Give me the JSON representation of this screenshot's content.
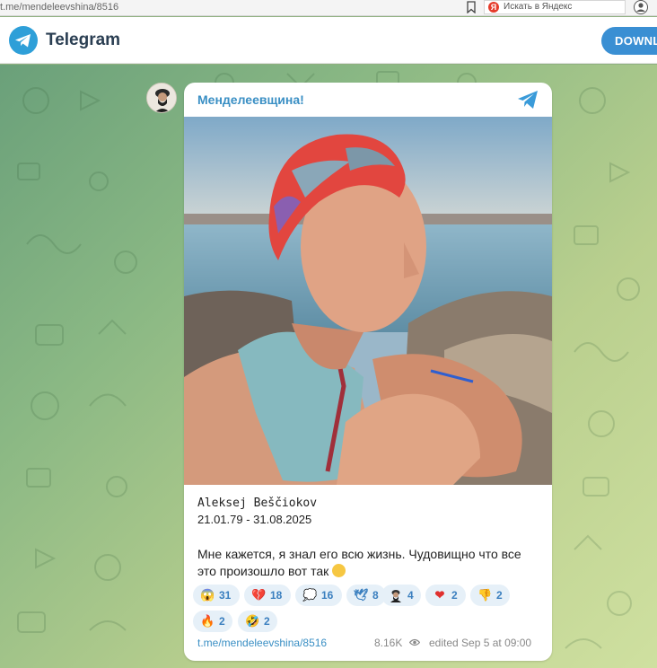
{
  "browser": {
    "url": "t.me/mendeleevshina/8516",
    "search_placeholder": "Искать в Яндекс",
    "search_engine_letter": "Я"
  },
  "header": {
    "brand": "Telegram",
    "download_label": "DOWNLO"
  },
  "post": {
    "channel_name": "Менделеевщина!",
    "person_name": "Aleksej Beščiokov",
    "dates": "21.01.79 - 31.08.2025",
    "text": "Мне кажется, я знал его всю жизнь. Чудовищно что все это произошло вот так",
    "reactions": [
      {
        "icon": "scream-emoji-icon",
        "glyph": "😱",
        "count": "31"
      },
      {
        "icon": "broken-heart-icon",
        "glyph": "💔",
        "count": "18"
      },
      {
        "icon": "speech-bubble-icon",
        "glyph": "💭",
        "count": "16"
      },
      {
        "icon": "dove-icon",
        "glyph": "🕊",
        "count": "8"
      },
      {
        "icon": "custom-avatar-emoji-icon",
        "glyph": "",
        "count": "4"
      },
      {
        "icon": "red-heart-icon",
        "glyph": "❤",
        "count": "2"
      },
      {
        "icon": "thumbs-down-icon",
        "glyph": "👎",
        "count": "2"
      },
      {
        "icon": "fire-icon",
        "glyph": "🔥",
        "count": "2"
      },
      {
        "icon": "rofl-emoji-icon",
        "glyph": "🤣",
        "count": "2"
      }
    ],
    "link": "t.me/mendeleevshina/8516",
    "views": "8.16K",
    "edited": "edited  Sep 5 at 09:00"
  },
  "colors": {
    "accent": "#3a8fc4",
    "reaction_bg": "#e6f0f8",
    "download_bg": "#3a8fd3"
  }
}
